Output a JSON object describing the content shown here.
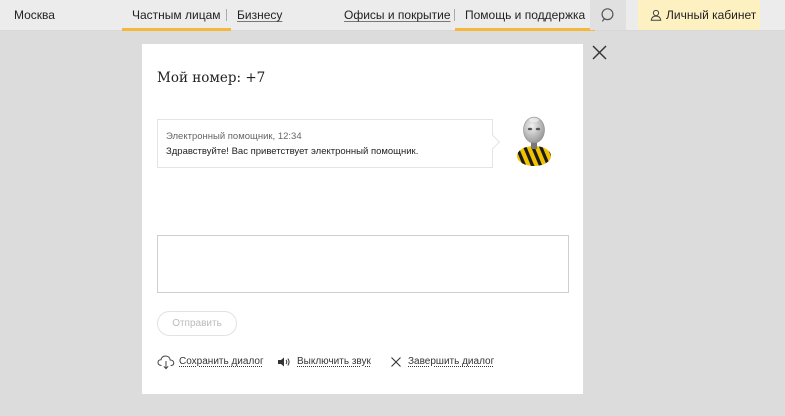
{
  "header": {
    "city": "Москва",
    "segments": [
      {
        "label": "Частным лицам",
        "active": true
      },
      {
        "label": "Бизнесу",
        "active": false
      }
    ],
    "nav": [
      {
        "label": "Офисы и покрытие",
        "active": false
      },
      {
        "label": "Помощь и поддержка",
        "active": true
      }
    ],
    "search_icon": "search-icon",
    "cabinet_label": "Личный кабинет"
  },
  "dialog": {
    "title": "Мой номер: +7",
    "messages": [
      {
        "sender": "Электронный помощник, 12:34",
        "text": "Здравствуйте! Вас приветствует электронный помощник."
      }
    ],
    "input_value": "",
    "send_label": "Отправить",
    "actions": {
      "save": "Сохранить диалог",
      "mute": "Выключить звук",
      "end": "Завершить диалог"
    }
  },
  "colors": {
    "accent": "#f5b83d",
    "cabinet_bg": "#fdf1c2",
    "overlay": "#dcdcdc"
  }
}
